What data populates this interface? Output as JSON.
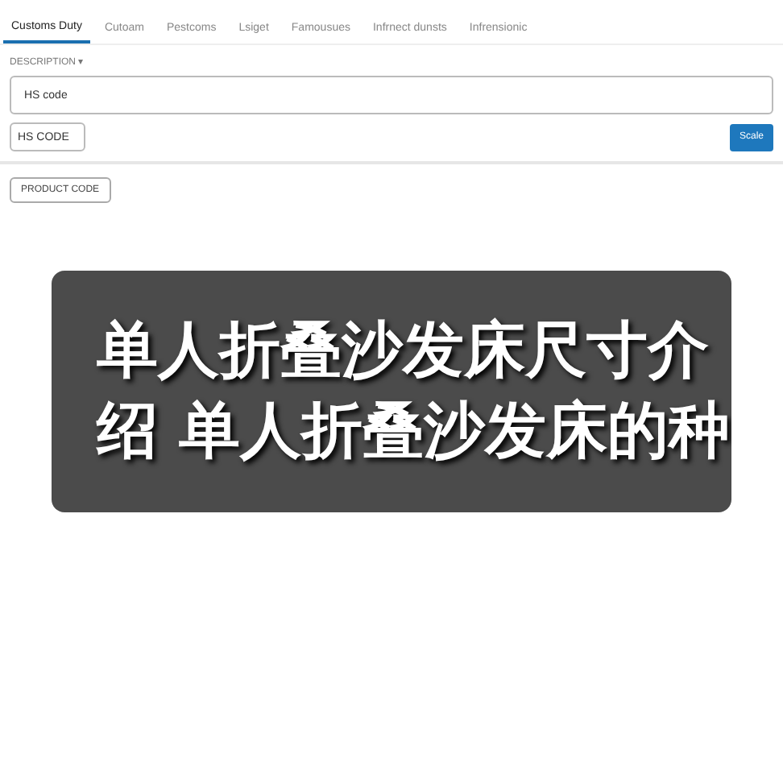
{
  "tabs": [
    {
      "label": "Customs Duty",
      "selected": true
    },
    {
      "label": "Cutoam",
      "selected": false
    },
    {
      "label": "Pestcoms",
      "selected": false
    },
    {
      "label": "Lsiget",
      "selected": false
    },
    {
      "label": "Famousues",
      "selected": false
    },
    {
      "label": "Infrnect dunsts",
      "selected": false
    },
    {
      "label": "Infrensionic",
      "selected": false
    }
  ],
  "description_label": "DESCRIPTION ▾",
  "description_field": {
    "value": "HS code"
  },
  "code_field": {
    "value": "HS CODE"
  },
  "search_button": "Scale",
  "product_code_button": "PRODUCT CODE",
  "caption": {
    "lines": [
      "单人折叠沙发床尺寸介",
      "绍 单人折叠沙发床的种"
    ]
  }
}
